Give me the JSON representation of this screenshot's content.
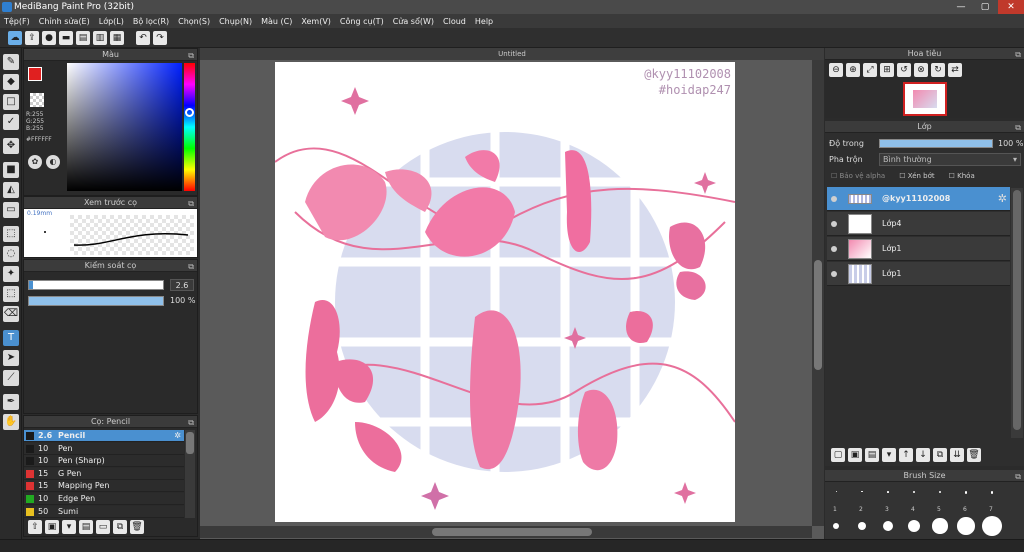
{
  "app": {
    "title": "MediBang Paint Pro (32bit)",
    "min": "—",
    "max": "▢",
    "close": "✕"
  },
  "menu": [
    "Tệp(F)",
    "Chỉnh sửa(E)",
    "Lớp(L)",
    "Bộ lọc(R)",
    "Chọn(S)",
    "Chụp(N)",
    "Màu (C)",
    "Xem(V)",
    "Công cụ(T)",
    "Cửa sổ(W)",
    "Cloud",
    "Help"
  ],
  "document": {
    "tab": "Untitled",
    "watermark1": "@kyy11102008",
    "watermark2": "#hoidap247"
  },
  "color_panel": {
    "title": "Màu",
    "r": "R:255",
    "g": "G:255",
    "b": "B:255",
    "hex": "#FFFFFF"
  },
  "preview_panel": {
    "title": "Xem trước cọ",
    "size": "0.19mm"
  },
  "brush_control": {
    "title": "Kiểm soát cọ",
    "size_value": "2.6",
    "opacity_value": "100 %",
    "size_fraction": 0.03,
    "opacity_fraction": 1.0
  },
  "brush_list": {
    "title": "Cọ: Pencil",
    "items": [
      {
        "size": "2.6",
        "name": "Pencil",
        "color": "#1a1a1a",
        "selected": true
      },
      {
        "size": "10",
        "name": "Pen",
        "color": "#1a1a1a"
      },
      {
        "size": "10",
        "name": "Pen (Sharp)",
        "color": "#1a1a1a"
      },
      {
        "size": "15",
        "name": "G Pen",
        "color": "#d33"
      },
      {
        "size": "15",
        "name": "Mapping Pen",
        "color": "#d33"
      },
      {
        "size": "10",
        "name": "Edge Pen",
        "color": "#2a2"
      },
      {
        "size": "50",
        "name": "Sumi",
        "color": "#e8c020"
      }
    ]
  },
  "navigator": {
    "title": "Hoa tiêu"
  },
  "layers_panel": {
    "title": "Lớp",
    "opacity_label": "Độ trong",
    "opacity_value": "100 %",
    "opacity_fraction": 1.0,
    "blend_label": "Pha trộn",
    "blend_value": "Bình thường",
    "protect_alpha": "Bảo vệ alpha",
    "clipping": "Xén bớt",
    "lock": "Khóa",
    "layers": [
      {
        "name": "@kyy11102008",
        "selected": true
      },
      {
        "name": "Lớp4"
      },
      {
        "name": "Lớp1"
      },
      {
        "name": "Lớp1"
      }
    ]
  },
  "brush_size": {
    "title": "Brush Size",
    "labels": [
      "1",
      "2",
      "3",
      "4",
      "5",
      "6",
      "7"
    ]
  },
  "colors": {
    "accent": "#4a90d0",
    "pink": "#e8709a",
    "lavender": "#d6dbf0"
  }
}
